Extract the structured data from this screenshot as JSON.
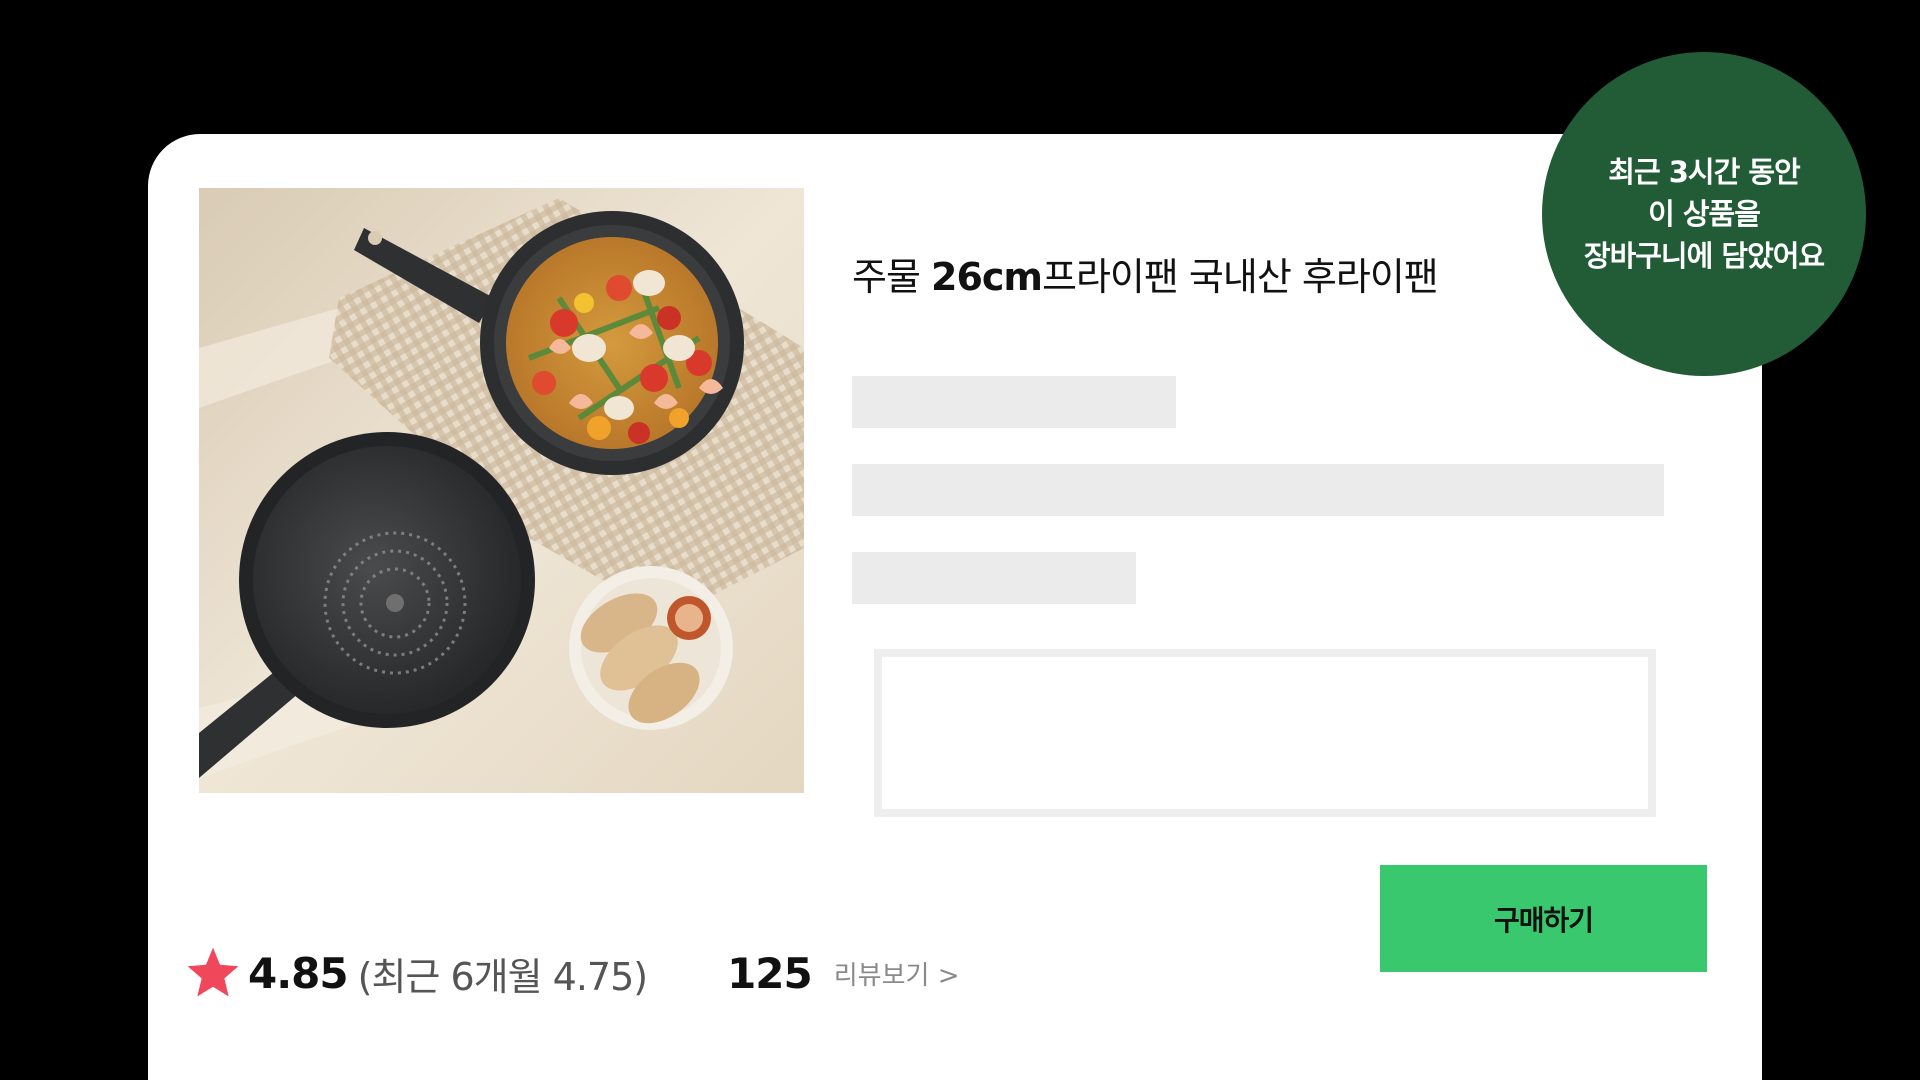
{
  "product": {
    "title_prefix": "주물 ",
    "title_size": "26cm",
    "title_rest": "프라이팬 국내산 후라이팬",
    "image_alt": "frying-pans-photo"
  },
  "purchase": {
    "buy_label": "구매하기"
  },
  "rating": {
    "score": "4.85",
    "recent": "(최근 6개월 4.75)",
    "review_count": "125",
    "review_link": "리뷰보기 >"
  },
  "badge": {
    "line1": "최근 3시간 동안",
    "line2": "이 상품을",
    "line3": "장바구니에 담았어요"
  },
  "colors": {
    "buy_button": "#39c86e",
    "badge": "#225c37",
    "star": "#f0485a",
    "skeleton": "#ebebec"
  }
}
